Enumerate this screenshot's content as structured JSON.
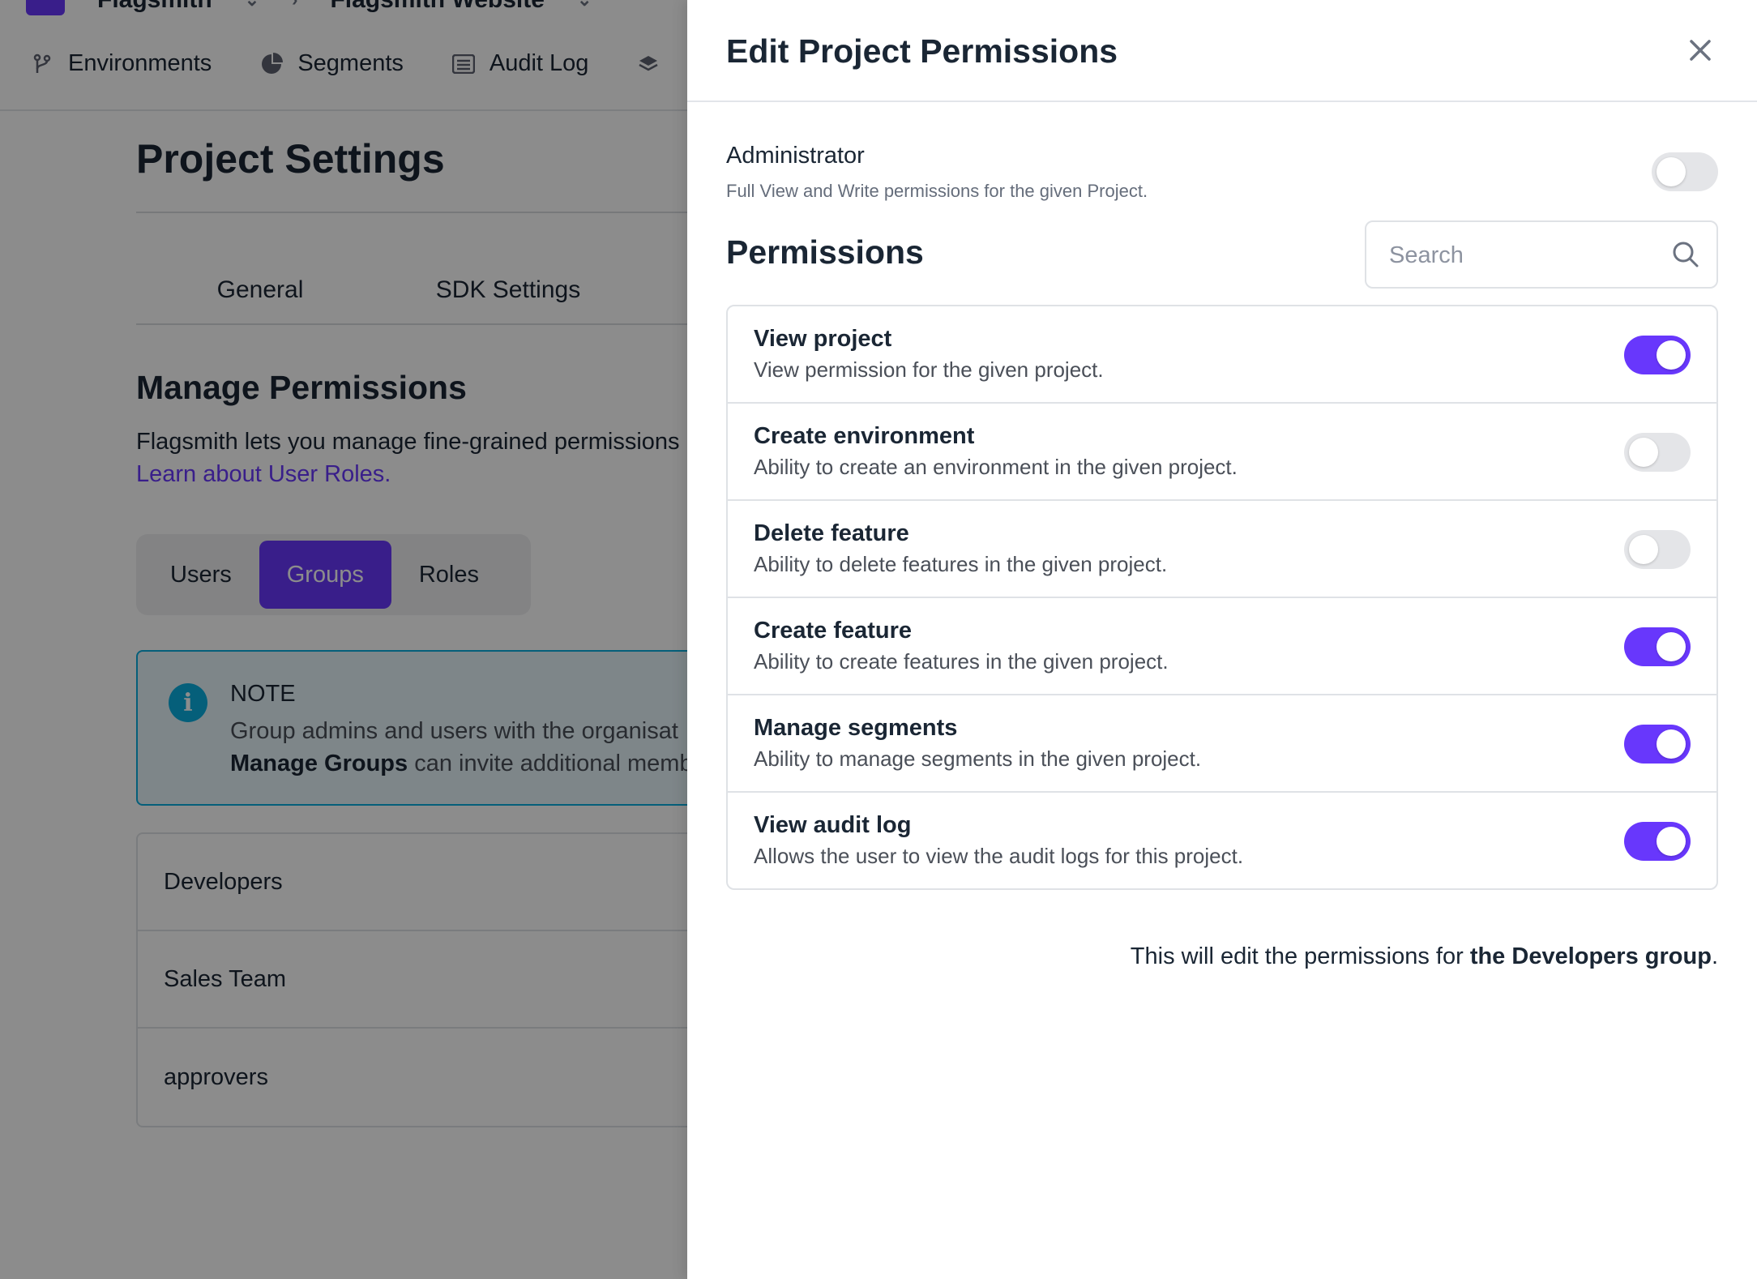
{
  "topbar": {
    "breadcrumbs": [
      "Flagsmith",
      "Flagsmith Website"
    ],
    "nav": [
      {
        "label": "Environments",
        "icon": "branch-icon"
      },
      {
        "label": "Segments",
        "icon": "pie-chart-icon"
      },
      {
        "label": "Audit Log",
        "icon": "list-icon"
      },
      {
        "label": "",
        "icon": "layers-icon"
      }
    ]
  },
  "settings": {
    "title": "Project Settings",
    "subtabs": [
      "General",
      "SDK Settings"
    ],
    "manage_title": "Manage Permissions",
    "manage_desc": "Flagsmith lets you manage fine-grained permissions",
    "learn_link": "Learn about User Roles.",
    "segment_tabs": [
      "Users",
      "Groups",
      "Roles"
    ],
    "active_segment_tab": "Groups",
    "note": {
      "title": "NOTE",
      "line1": "Group admins and users with the organisat",
      "line2_bold": "Manage Groups",
      "line2_rest": " can invite additional memb"
    },
    "groups": [
      "Developers",
      "Sales Team",
      "approvers"
    ]
  },
  "panel": {
    "title": "Edit Project Permissions",
    "admin": {
      "label": "Administrator",
      "description": "Full View and Write permissions for the given Project.",
      "enabled": false
    },
    "permissions_heading": "Permissions",
    "search": {
      "placeholder": "Search",
      "value": ""
    },
    "permissions": [
      {
        "name": "View project",
        "description": "View permission for the given project.",
        "enabled": true
      },
      {
        "name": "Create environment",
        "description": "Ability to create an environment in the given project.",
        "enabled": false
      },
      {
        "name": "Delete feature",
        "description": "Ability to delete features in the given project.",
        "enabled": false
      },
      {
        "name": "Create feature",
        "description": "Ability to create features in the given project.",
        "enabled": true
      },
      {
        "name": "Manage segments",
        "description": "Ability to manage segments in the given project.",
        "enabled": true
      },
      {
        "name": "View audit log",
        "description": "Allows the user to view the audit logs for this project.",
        "enabled": true
      }
    ],
    "footer": {
      "prefix": "This will edit the permissions for ",
      "bold": "the Developers group",
      "suffix": "."
    }
  },
  "colors": {
    "accent": "#6837fc",
    "toggle_off": "#e4e5e8",
    "note_border": "#0aaddf"
  }
}
